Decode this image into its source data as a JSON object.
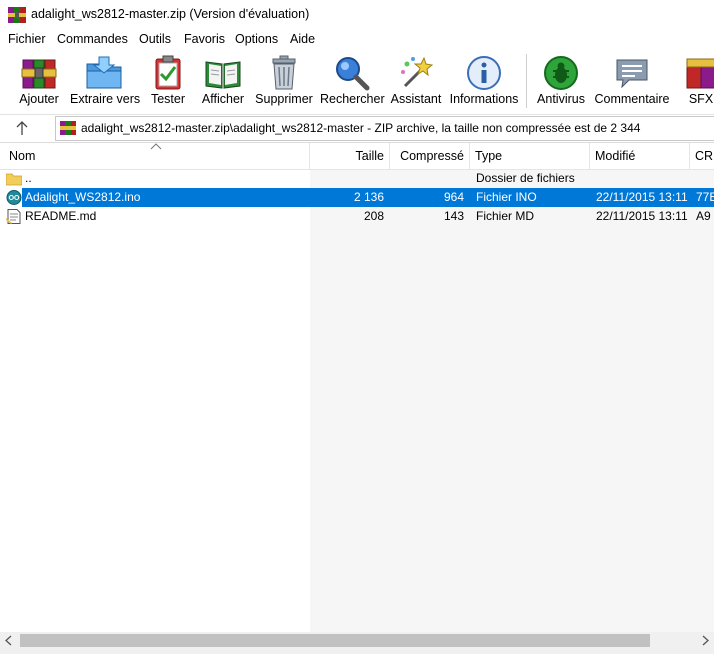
{
  "window": {
    "title": "adalight_ws2812-master.zip (Version d'évaluation)"
  },
  "menu": [
    "Fichier",
    "Commandes",
    "Outils",
    "Favoris",
    "Options",
    "Aide"
  ],
  "toolbar": {
    "buttons": [
      {
        "label": "Ajouter",
        "icon": "add-archive-icon"
      },
      {
        "label": "Extraire vers",
        "icon": "extract-folder-icon"
      },
      {
        "label": "Tester",
        "icon": "test-clipboard-icon"
      },
      {
        "label": "Afficher",
        "icon": "view-book-icon"
      },
      {
        "label": "Supprimer",
        "icon": "trash-icon"
      },
      {
        "label": "Rechercher",
        "icon": "magnifier-icon"
      },
      {
        "label": "Assistant",
        "icon": "magic-wand-icon"
      },
      {
        "label": "Informations",
        "icon": "info-icon"
      },
      {
        "label": "Antivirus",
        "icon": "antivirus-bug-icon"
      },
      {
        "label": "Commentaire",
        "icon": "comment-icon"
      },
      {
        "label": "SFX",
        "icon": "sfx-boxes-icon"
      }
    ]
  },
  "address": {
    "path": "adalight_ws2812-master.zip\\adalight_ws2812-master - ZIP archive, la taille non compressée est de 2 344"
  },
  "columns": [
    "Nom",
    "Taille",
    "Compressé",
    "Type",
    "Modifié",
    "CR"
  ],
  "rows": [
    {
      "name": "..",
      "size": "",
      "packed": "",
      "type": "Dossier de fichiers",
      "modified": "",
      "crc": "",
      "icon": "folder-icon",
      "selected": false
    },
    {
      "name": "Adalight_WS2812.ino",
      "size": "2 136",
      "packed": "964",
      "type": "Fichier INO",
      "modified": "22/11/2015 13:11",
      "crc": "77E",
      "icon": "arduino-file-icon",
      "selected": true
    },
    {
      "name": "README.md",
      "size": "208",
      "packed": "143",
      "type": "Fichier MD",
      "modified": "22/11/2015 13:11",
      "crc": "A9",
      "icon": "text-file-icon",
      "selected": false
    }
  ],
  "colors": {
    "selection": "#0078d7",
    "background": "#ffffff",
    "gray_area": "#f6f6f6"
  }
}
